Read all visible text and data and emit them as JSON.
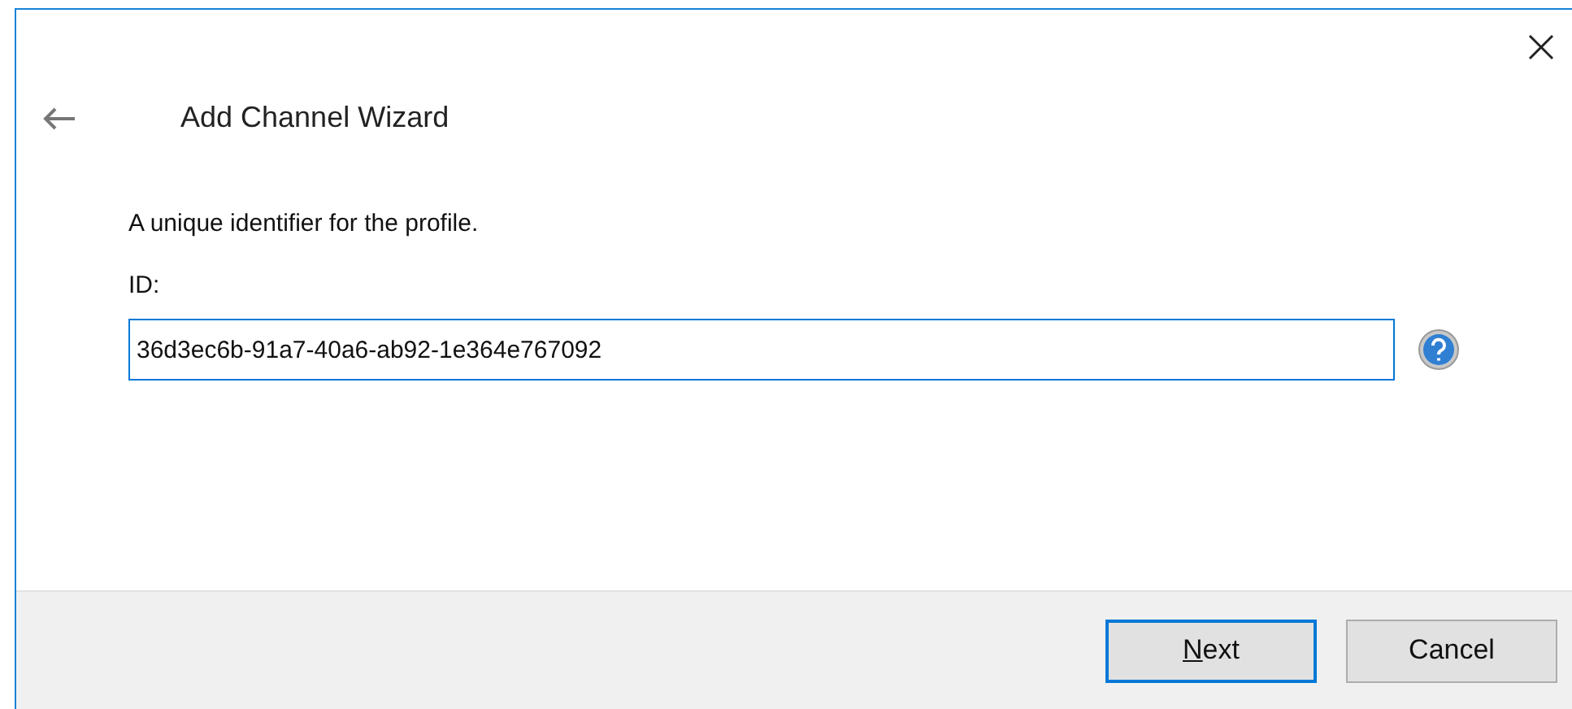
{
  "wizard": {
    "title": "Add Channel Wizard"
  },
  "description": "A unique identifier for the profile.",
  "field": {
    "label": "ID:",
    "value": "36d3ec6b-91a7-40a6-ab92-1e364e767092",
    "focused": true
  },
  "buttons": [
    {
      "label": "Next",
      "focused": true
    },
    {
      "label": "Cancel",
      "focused": false
    }
  ]
}
